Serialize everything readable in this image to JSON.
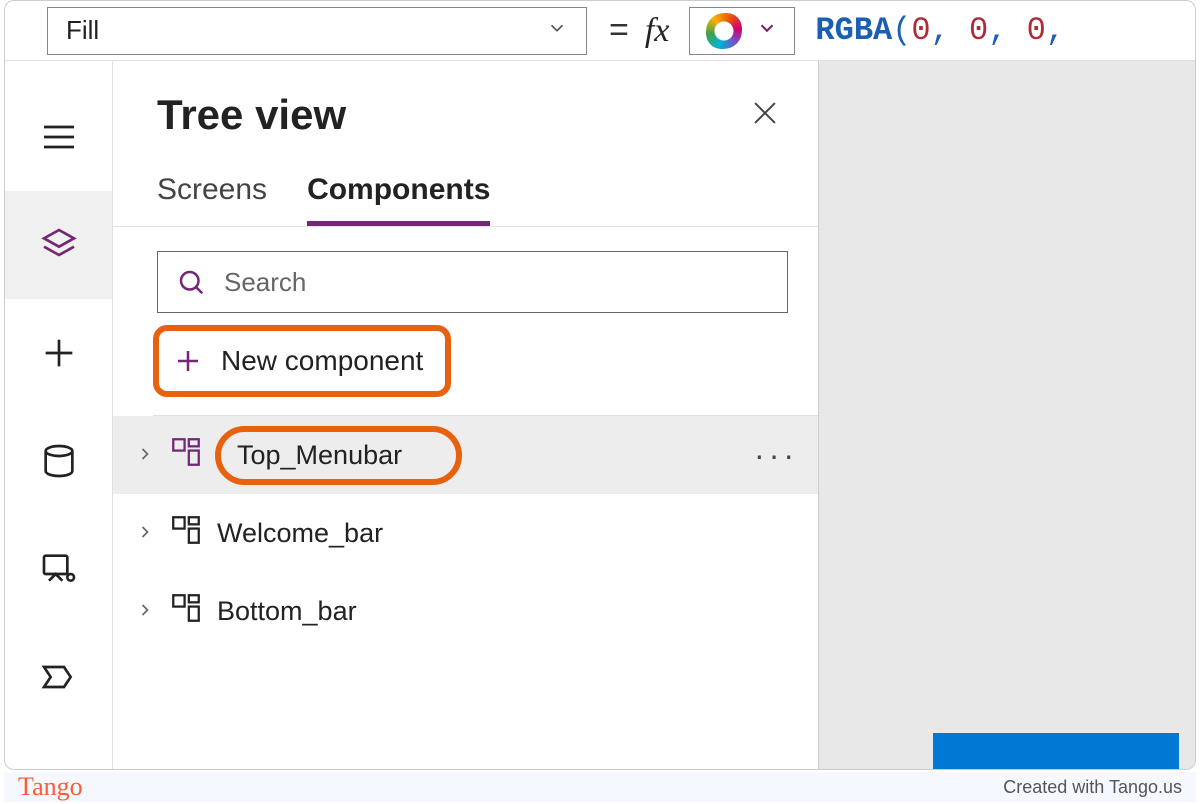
{
  "formula_bar": {
    "property": "Fill",
    "equals": "=",
    "fx_label": "fx",
    "rgba_fn": "RGBA",
    "rgba_args_display": "(0, 0, 0,"
  },
  "tree_view": {
    "title": "Tree view",
    "tabs": {
      "screens": "Screens",
      "components": "Components"
    },
    "search_placeholder": "Search",
    "new_component_label": "New component",
    "items": [
      {
        "label": "Top_Menubar"
      },
      {
        "label": "Welcome_bar"
      },
      {
        "label": "Bottom_bar"
      }
    ],
    "more": "···"
  },
  "footer": {
    "logo": "Tango",
    "credit": "Created with Tango.us"
  }
}
